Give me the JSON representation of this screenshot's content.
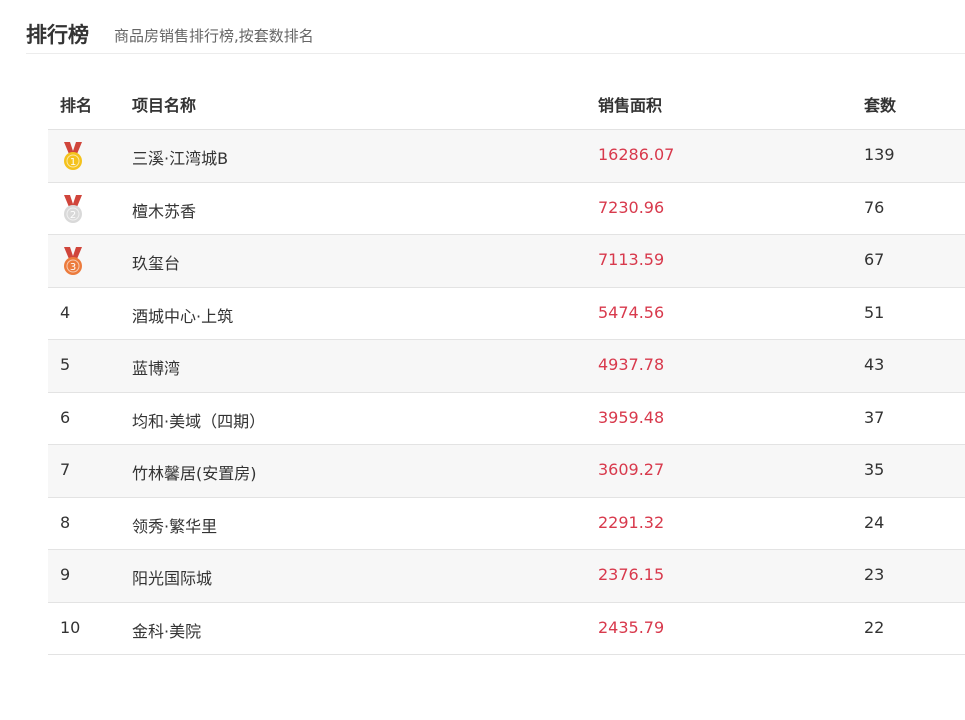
{
  "header": {
    "title": "排行榜",
    "subtitle": "商品房销售排行榜,按套数排名"
  },
  "table": {
    "columns": [
      "排名",
      "项目名称",
      "销售面积",
      "套数"
    ],
    "rows": [
      {
        "rank": "1",
        "medal": "gold-medal-icon",
        "name": "三溪·江湾城B",
        "area": "16286.07",
        "count": "139"
      },
      {
        "rank": "2",
        "medal": "silver-medal-icon",
        "name": "檀木苏香",
        "area": "7230.96",
        "count": "76"
      },
      {
        "rank": "3",
        "medal": "bronze-medal-icon",
        "name": "玖玺台",
        "area": "7113.59",
        "count": "67"
      },
      {
        "rank": "4",
        "name": "酒城中心·上筑",
        "area": "5474.56",
        "count": "51"
      },
      {
        "rank": "5",
        "name": "蓝博湾",
        "area": "4937.78",
        "count": "43"
      },
      {
        "rank": "6",
        "name": "均和·美域（四期）",
        "area": "3959.48",
        "count": "37"
      },
      {
        "rank": "7",
        "name": "竹林馨居(安置房)",
        "area": "3609.27",
        "count": "35"
      },
      {
        "rank": "8",
        "name": "领秀·繁华里",
        "area": "2291.32",
        "count": "24"
      },
      {
        "rank": "9",
        "name": "阳光国际城",
        "area": "2376.15",
        "count": "23"
      },
      {
        "rank": "10",
        "name": "金科·美院",
        "area": "2435.79",
        "count": "22"
      }
    ]
  },
  "colors": {
    "area_text": "#d8394c",
    "gold": "#f4c21c",
    "silver": "#d9d9d9",
    "bronze": "#ec7b3c",
    "ribbon": "#d0453b"
  }
}
